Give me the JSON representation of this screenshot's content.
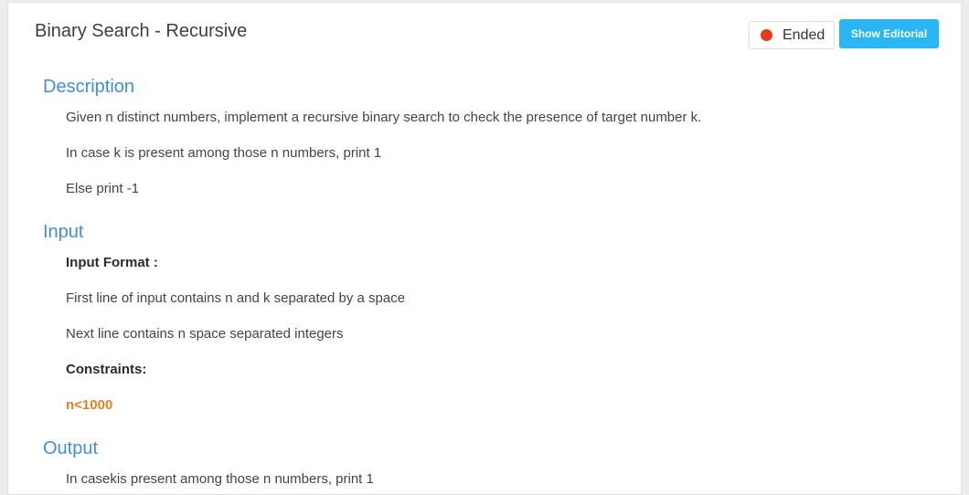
{
  "problem": {
    "title": "Binary Search - Recursive",
    "status": "Ended",
    "editorial_button": "Show Editorial",
    "colors": {
      "status_dot": "#e8391d",
      "button_bg": "#29b6f6",
      "heading": "#3f8ee0",
      "constraint": "#e67e22"
    }
  },
  "description": {
    "heading": "Description",
    "lines": [
      "Given n distinct numbers, implement a recursive binary search to check the presence of target number k.",
      "In case k is present among those n numbers, print 1",
      "Else print -1"
    ]
  },
  "input": {
    "heading": "Input",
    "format_label": "Input Format :",
    "lines": [
      "First line of input contains n and k separated by a space",
      "Next line contains n space separated integers"
    ],
    "constraints_label": "Constraints:",
    "constraint_value": "n<1000"
  },
  "output": {
    "heading": "Output",
    "lines": [
      "In casekis present among those n numbers, print 1"
    ]
  }
}
